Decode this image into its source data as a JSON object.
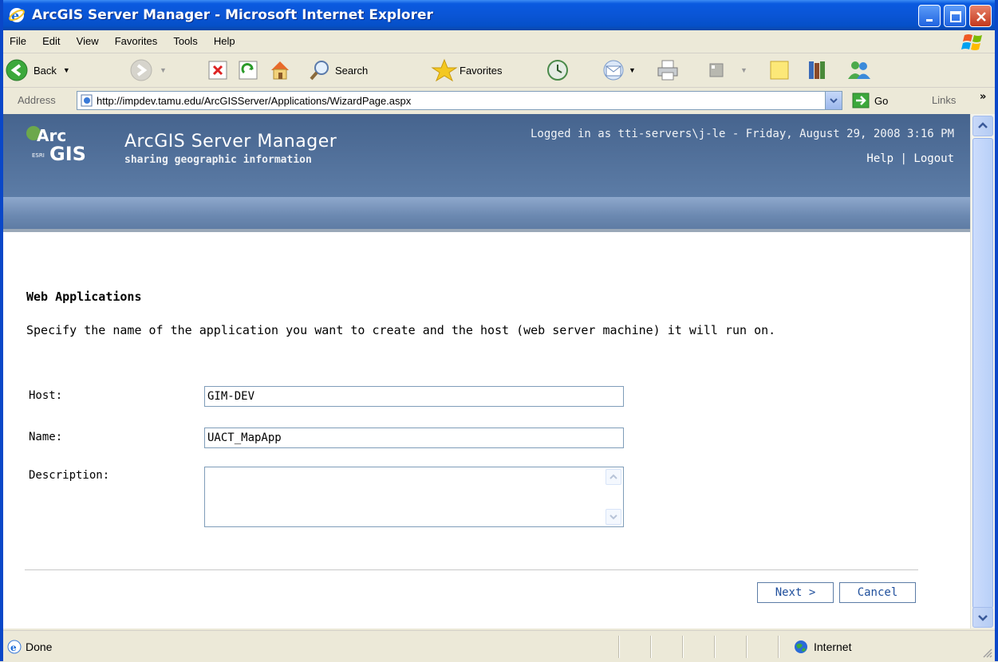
{
  "window": {
    "title": "ArcGIS Server Manager - Microsoft Internet Explorer"
  },
  "menu": [
    "File",
    "Edit",
    "View",
    "Favorites",
    "Tools",
    "Help"
  ],
  "toolbar": {
    "back_label": "Back",
    "search_label": "Search",
    "favorites_label": "Favorites"
  },
  "address": {
    "label": "Address",
    "url": "http://impdev.tamu.edu/ArcGISServer/Applications/WizardPage.aspx",
    "go_label": "Go",
    "links_label": "Links"
  },
  "header": {
    "logo_top": "Arc",
    "logo_bottom": "GIS",
    "logo_esri": "ESRI",
    "app_title": "ArcGIS Server Manager",
    "app_subtitle": "sharing geographic information",
    "login_text": "Logged in as tti-servers\\j-le - Friday, August 29, 2008 3:16 PM",
    "help_label": "Help",
    "separator": "|",
    "logout_label": "Logout"
  },
  "page": {
    "heading": "Web Applications",
    "instructions": "Specify the name of the application you want to create and the host (web server machine) it will run on.",
    "fields": {
      "host_label": "Host:",
      "host_value": "GIM-DEV",
      "name_label": "Name:",
      "name_value": "UACT_MapApp",
      "description_label": "Description:",
      "description_value": ""
    },
    "next_label": "Next >",
    "cancel_label": "Cancel"
  },
  "status": {
    "text": "Done",
    "zone": "Internet"
  }
}
